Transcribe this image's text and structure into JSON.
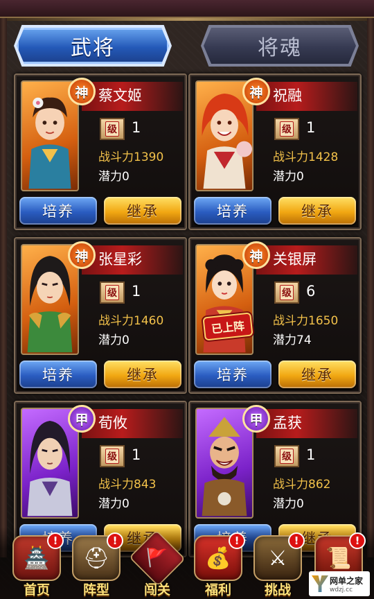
{
  "tabs": {
    "generals": "武将",
    "souls": "将魂"
  },
  "cards": [
    {
      "rank": "神",
      "name": "蔡文姬",
      "level": "1",
      "power": "战斗力1390",
      "potential": "潜力0",
      "train": "培养",
      "inherit": "继承",
      "level_icon": "级"
    },
    {
      "rank": "神",
      "name": "祝融",
      "level": "1",
      "power": "战斗力1428",
      "potential": "潜力0",
      "train": "培养",
      "inherit": "继承",
      "level_icon": "级"
    },
    {
      "rank": "神",
      "name": "张星彩",
      "level": "1",
      "power": "战斗力1460",
      "potential": "潜力0",
      "train": "培养",
      "inherit": "继承",
      "level_icon": "级"
    },
    {
      "rank": "神",
      "name": "关银屏",
      "level": "6",
      "power": "战斗力1650",
      "potential": "潜力74",
      "train": "培养",
      "inherit": "继承",
      "level_icon": "级",
      "deployed": "已上阵"
    },
    {
      "rank": "甲",
      "name": "荀攸",
      "level": "1",
      "power": "战斗力843",
      "potential": "潜力0",
      "train": "培养",
      "inherit": "继承",
      "level_icon": "级"
    },
    {
      "rank": "甲",
      "name": "孟获",
      "level": "1",
      "power": "战斗力862",
      "potential": "潜力0",
      "train": "培养",
      "inherit": "继承",
      "level_icon": "级"
    }
  ],
  "bottom_nav": [
    {
      "label": "首页",
      "icon": "palace-icon",
      "alert": "!"
    },
    {
      "label": "阵型",
      "icon": "helmet-icon",
      "alert": "!"
    },
    {
      "label": "闯关",
      "icon": "battle-flag-icon"
    },
    {
      "label": "福利",
      "icon": "money-bag-icon",
      "alert": "!"
    },
    {
      "label": "挑战",
      "icon": "swords-icon",
      "alert": "!"
    },
    {
      "label": "",
      "icon": "scroll-icon",
      "alert": "!"
    }
  ],
  "watermark": {
    "title": "网单之家",
    "url": "wdzj.cc"
  },
  "colors": {
    "power_text": "#f3c24a",
    "train_button": "#2a5cc0",
    "inherit_button": "#f1a712",
    "rank_shen": "#c23b05",
    "rank_jia": "#6a1ab0"
  }
}
